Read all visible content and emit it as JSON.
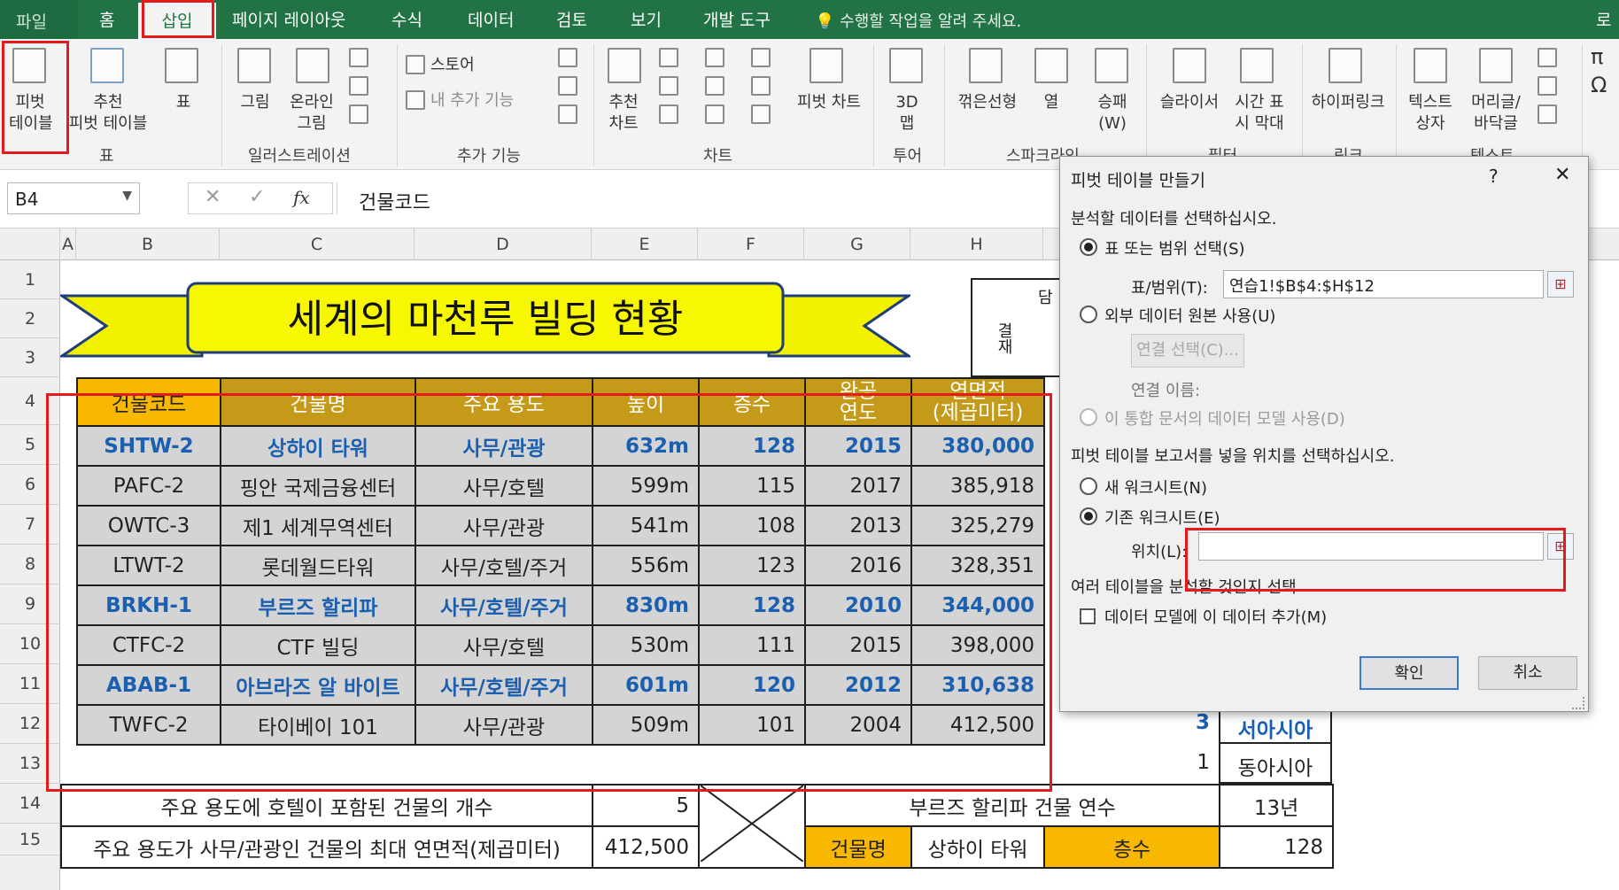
{
  "tabs": {
    "file": "파일",
    "home": "홈",
    "insert": "삽입",
    "layout": "페이지 레이아웃",
    "formulas": "수식",
    "data": "데이터",
    "review": "검토",
    "view": "보기",
    "developer": "개발 도구",
    "tell_me": "수행할 작업을 알려 주세요.",
    "overflow": "로"
  },
  "ribbon": {
    "pivot_table": [
      "피벗",
      "테이블"
    ],
    "recommended_pivot": [
      "추천",
      "피벗 테이블"
    ],
    "table": "표",
    "group_tables": "표",
    "pictures": "그림",
    "online_pictures": [
      "온라인",
      "그림"
    ],
    "group_illustrations": "일러스트레이션",
    "store": "스토어",
    "my_addins": "내 추가 기능",
    "group_addins": "추가 기능",
    "recommended_charts": [
      "추천",
      "차트"
    ],
    "pivot_chart": "피벗 차트",
    "group_charts": "차트",
    "map3d": [
      "3D",
      "맵"
    ],
    "group_tours": "투어",
    "spark_line": "꺾은선형",
    "spark_column": "열",
    "spark_winloss": [
      "승패",
      "(W)"
    ],
    "group_sparklines": "스파크라인",
    "slicer": "슬라이서",
    "timeline": [
      "시간 표",
      "시 막대"
    ],
    "group_filters": "필터",
    "hyperlink": "하이퍼링크",
    "group_links": "링크",
    "textbox": [
      "텍스트",
      "상자"
    ],
    "header_footer": [
      "머리글/",
      "바닥글"
    ],
    "group_text": "텍스트",
    "symbols": [
      "π",
      "Ω"
    ]
  },
  "formula_bar": {
    "cell_ref": "B4",
    "cancel": "✕",
    "enter": "✓",
    "fx": "fx",
    "value": "건물코드"
  },
  "columns": [
    "A",
    "B",
    "C",
    "D",
    "E",
    "F",
    "G",
    "H"
  ],
  "rows": [
    "1",
    "2",
    "3",
    "4",
    "5",
    "6",
    "7",
    "8",
    "9",
    "10",
    "11",
    "12",
    "13",
    "14",
    "15"
  ],
  "sheet": {
    "banner_title": "세계의 마천루 빌딩 현황",
    "approval": {
      "label": "결재",
      "partial": "담"
    },
    "headers": [
      "건물코드",
      "건물명",
      "주요 용도",
      "높이",
      "층수",
      "완공\n연도",
      "연면적\n(제곱미터)"
    ],
    "rows": [
      {
        "code": "SHTW-2",
        "name": "상하이 타워",
        "use": "사무/관광",
        "height": "632m",
        "floors": "128",
        "year": "2015",
        "area": "380,000",
        "highlight": true
      },
      {
        "code": "PAFC-2",
        "name": "핑안 국제금융센터",
        "use": "사무/호텔",
        "height": "599m",
        "floors": "115",
        "year": "2017",
        "area": "385,918",
        "highlight": false
      },
      {
        "code": "OWTC-3",
        "name": "제1 세계무역센터",
        "use": "사무/관광",
        "height": "541m",
        "floors": "108",
        "year": "2013",
        "area": "325,279",
        "highlight": false
      },
      {
        "code": "LTWT-2",
        "name": "롯데월드타워",
        "use": "사무/호텔/주거",
        "height": "556m",
        "floors": "123",
        "year": "2016",
        "area": "328,351",
        "highlight": false
      },
      {
        "code": "BRKH-1",
        "name": "부르즈 할리파",
        "use": "사무/호텔/주거",
        "height": "830m",
        "floors": "128",
        "year": "2010",
        "area": "344,000",
        "highlight": true
      },
      {
        "code": "CTFC-2",
        "name": "CTF 빌딩",
        "use": "사무/호텔",
        "height": "530m",
        "floors": "111",
        "year": "2015",
        "area": "398,000",
        "highlight": false
      },
      {
        "code": "ABAB-1",
        "name": "아브라즈 알 바이트",
        "use": "사무/호텔/주거",
        "height": "601m",
        "floors": "120",
        "year": "2012",
        "area": "310,638",
        "highlight": true
      },
      {
        "code": "TWFC-2",
        "name": "타이베이 101",
        "use": "사무/관광",
        "height": "509m",
        "floors": "101",
        "year": "2004",
        "area": "412,500",
        "highlight": false
      }
    ],
    "side": {
      "r11_num": "3",
      "r11_region": "서아시아",
      "r12_num": "1",
      "r12_region": "동아시아"
    },
    "footer": {
      "r13_label": "주요 용도에 호텔이 포함된 건물의 개수",
      "r13_value": "5",
      "r13_label2": "부르즈 할리파 건물 연수",
      "r13_value2": "13년",
      "r14_label": "주요 용도가 사무/관광인 건물의 최대 연면적(제곱미터)",
      "r14_value": "412,500",
      "r14_key1": "건물명",
      "r14_val1": "상하이 타워",
      "r14_key2": "층수",
      "r14_val2": "128"
    }
  },
  "dialog": {
    "title": "피벗 테이블 만들기",
    "help": "?",
    "close": "✕",
    "section1": "분석할 데이터를 선택하십시오.",
    "opt_table": "표 또는 범위 선택(S)",
    "range_label": "표/범위(T):",
    "range_value": "연습1!$B$4:$H$12",
    "opt_external": "외부 데이터 원본 사용(U)",
    "choose_conn": "연결 선택(C)...",
    "conn_name": "연결 이름:",
    "opt_model": "이 통합 문서의 데이터 모델 사용(D)",
    "section2": "피벗 테이블 보고서를 넣을 위치를 선택하십시오.",
    "opt_new": "새 워크시트(N)",
    "opt_existing": "기존 워크시트(E)",
    "location_label": "위치(L):",
    "location_value": "",
    "section3": "여러 테이블을 분석할 것인지 선택",
    "add_model": "데이터 모델에 이 데이터 추가(M)",
    "ok": "확인",
    "cancel": "취소"
  }
}
